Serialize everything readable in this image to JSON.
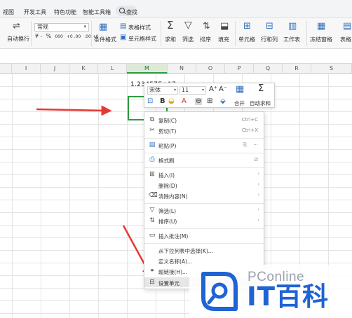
{
  "tabs": [
    "视图",
    "开发工具",
    "特色功能",
    "智能工具箱"
  ],
  "search_label": "查找",
  "ribbon": {
    "wrap_text": "自动换行",
    "number_format": "常规",
    "number_buttons": [
      "¥ -",
      "%",
      "000",
      "+0 .00",
      ".00 +0"
    ],
    "conditional_format": "条件格式",
    "table_style": "表格样式",
    "cell_style": "单元格样式",
    "sum": "求和",
    "filter": "筛选",
    "sort": "排序",
    "fill": "填充",
    "cell": "单元格",
    "row_col": "行和列",
    "worksheet": "工作表",
    "freeze": "冻结窗格",
    "table": "表格"
  },
  "columns": [
    "I",
    "J",
    "K",
    "L",
    "M",
    "N",
    "O",
    "P",
    "Q",
    "R",
    "S"
  ],
  "active_column": "M",
  "cell_value": "1.23457E+17",
  "minibar": {
    "font": "宋体",
    "size": "11",
    "grow": "A⁺",
    "shrink": "A⁻",
    "merge": "合并",
    "autosum": "自动求和"
  },
  "context_menu": [
    {
      "label": "复制(C)",
      "shortcut": "Ctrl+C",
      "icon": "copy-icon"
    },
    {
      "label": "剪切(T)",
      "shortcut": "Ctrl+X",
      "icon": "scissors-icon"
    },
    {
      "label": "粘贴(P)",
      "shortcut": "",
      "icon": "paste-icon"
    },
    {
      "label": "格式刷",
      "shortcut": "",
      "icon": "format-painter-icon"
    },
    {
      "label": "插入(I)",
      "shortcut": "",
      "icon": "insert-icon"
    },
    {
      "label": "删除(D)",
      "shortcut": "",
      "icon": ""
    },
    {
      "label": "清除内容(N)",
      "shortcut": "",
      "icon": "eraser-icon"
    },
    {
      "label": "筛选(L)",
      "shortcut": "",
      "icon": "filter-icon"
    },
    {
      "label": "排序(U)",
      "shortcut": "",
      "icon": "sort-icon"
    },
    {
      "label": "插入批注(M)",
      "shortcut": "",
      "icon": "comment-icon"
    },
    {
      "label": "从下拉列表中选择(K)...",
      "shortcut": "",
      "icon": ""
    },
    {
      "label": "定义名称(A)...",
      "shortcut": "",
      "icon": ""
    },
    {
      "label": "超链接(H)...",
      "shortcut": "",
      "icon": "link-icon"
    },
    {
      "label": "设置单元",
      "shortcut": "",
      "icon": "format-cells-icon"
    }
  ],
  "watermark": {
    "top": "PConline",
    "big": "IT百科"
  },
  "colors": {
    "accent_green": "#2e9b42",
    "arrow_red": "#e53935",
    "brand_blue": "#1f63d4"
  }
}
